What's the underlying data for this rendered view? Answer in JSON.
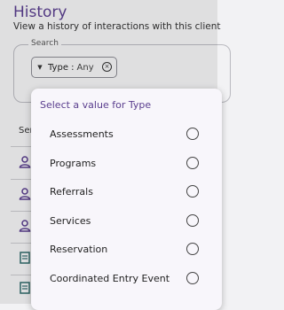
{
  "page": {
    "title": "History",
    "subtitle": "View a history of interactions with this client"
  },
  "search": {
    "legend": "Search",
    "chip": {
      "label": "Type :",
      "value": "Any"
    }
  },
  "table": {
    "header_partial": "Ser"
  },
  "rows": [
    {
      "icon": "person-icon"
    },
    {
      "icon": "person-icon"
    },
    {
      "icon": "person-icon"
    },
    {
      "icon": "document-icon"
    },
    {
      "icon": "document-icon"
    }
  ],
  "popup": {
    "title": "Select a value for Type",
    "options": [
      "Assessments",
      "Programs",
      "Referrals",
      "Services",
      "Reservation",
      "Coordinated Entry Event"
    ]
  },
  "colors": {
    "accent": "#5a3e8e",
    "background": "#f2f2f4",
    "popup_bg": "#f8f6fb"
  }
}
